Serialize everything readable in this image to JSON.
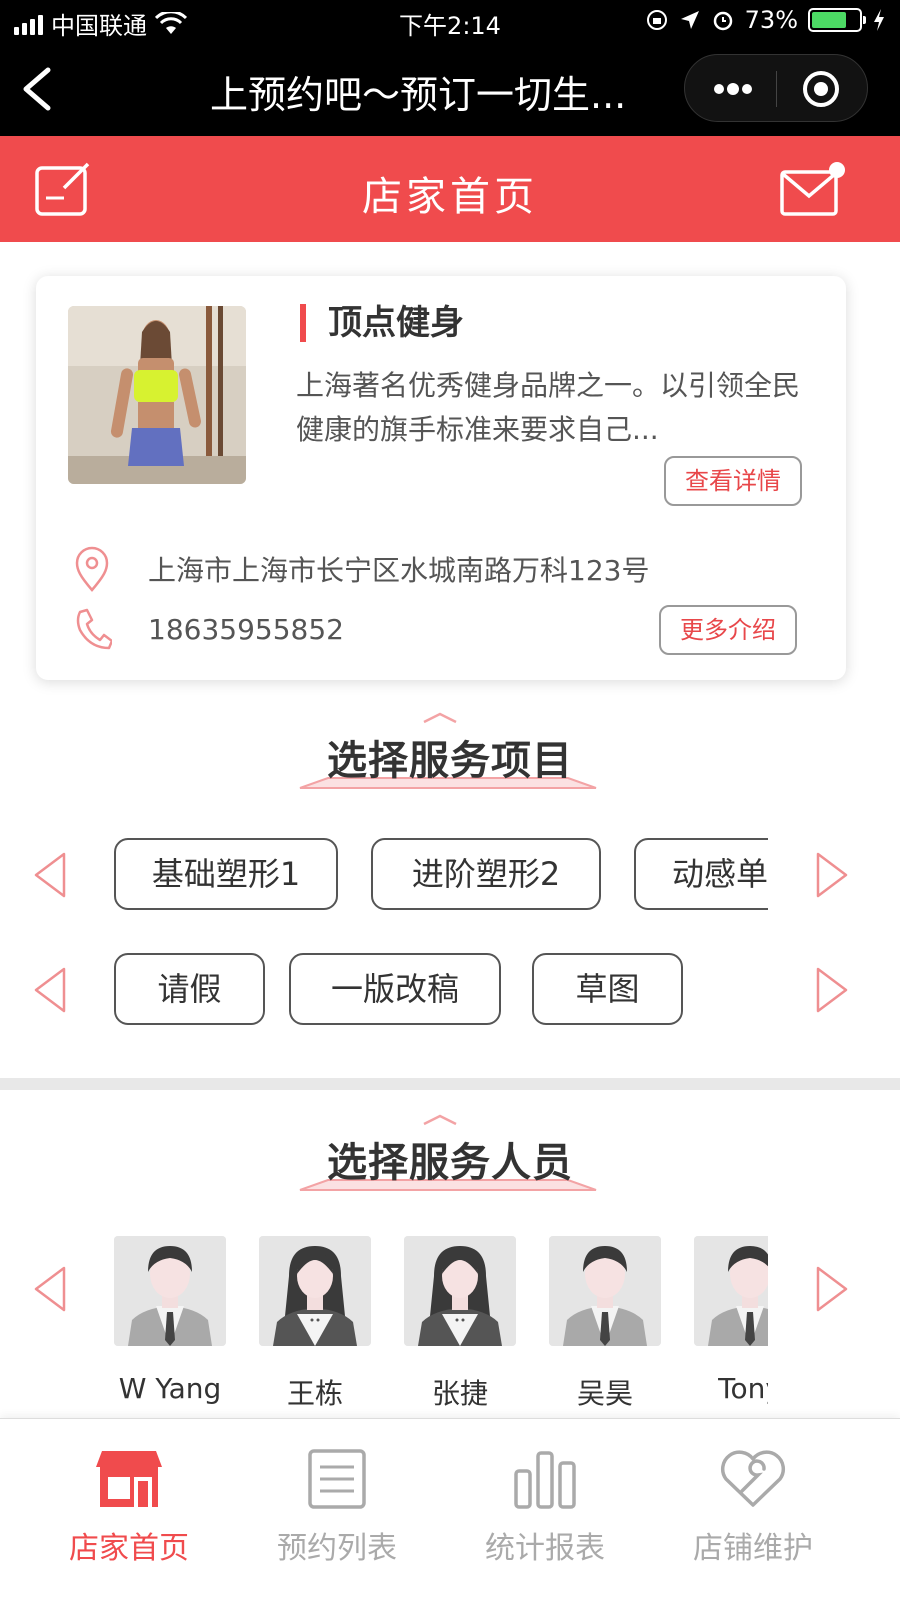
{
  "status_bar": {
    "carrier": "中国联通",
    "time": "下午2:14",
    "battery": "73%",
    "battery_level": 0.73
  },
  "nav": {
    "title": "上预约吧～预订一切生..."
  },
  "header": {
    "title": "店家首页"
  },
  "store": {
    "name": "顶点健身",
    "description": "上海著名优秀健身品牌之一。以引领全民健康的旗手标准来要求自己...",
    "details_label": "查看详情",
    "address": "上海市上海市长宁区水城南路万科123号",
    "phone": "18635955852",
    "more_label": "更多介绍"
  },
  "services": {
    "title": "选择服务项目",
    "row1": [
      "基础塑形1",
      "进阶塑形2",
      "动感单车"
    ],
    "row2": [
      "请假",
      "一版改稿",
      "草图"
    ]
  },
  "staff": {
    "title": "选择服务人员",
    "members": [
      {
        "name": "W Yang",
        "gender": "male"
      },
      {
        "name": "王栋",
        "gender": "female"
      },
      {
        "name": "张捷",
        "gender": "female"
      },
      {
        "name": "吴昊",
        "gender": "male"
      },
      {
        "name": "Tony",
        "gender": "male"
      }
    ]
  },
  "tabbar": {
    "items": [
      {
        "label": "店家首页",
        "icon": "store-icon",
        "active": true
      },
      {
        "label": "预约列表",
        "icon": "list-icon",
        "active": false
      },
      {
        "label": "统计报表",
        "icon": "chart-icon",
        "active": false
      },
      {
        "label": "店铺维护",
        "icon": "heart-wrench-icon",
        "active": false
      }
    ]
  },
  "colors": {
    "accent": "#f04b4d",
    "inactive": "#aaaaaa"
  }
}
